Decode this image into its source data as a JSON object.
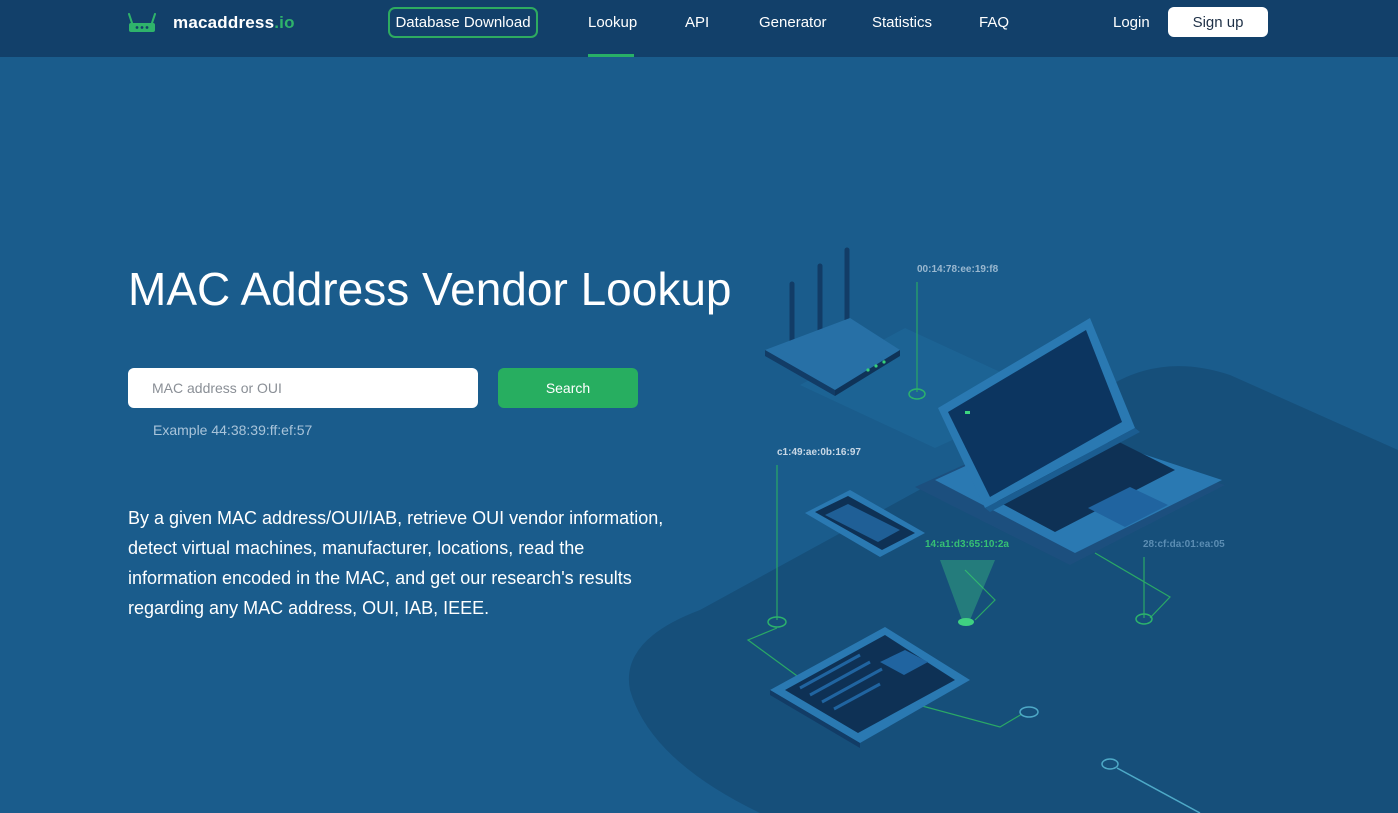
{
  "header": {
    "logo_name": "macaddress",
    "logo_tld": ".io",
    "db_button": "Database Download",
    "nav": [
      {
        "label": "Lookup",
        "active": true
      },
      {
        "label": "API"
      },
      {
        "label": "Generator"
      },
      {
        "label": "Statistics"
      },
      {
        "label": "FAQ"
      }
    ],
    "login": "Login",
    "signup": "Sign up"
  },
  "hero": {
    "title": "MAC Address Vendor Lookup",
    "search_placeholder": "MAC address or OUI",
    "search_button": "Search",
    "example": "Example 44:38:39:ff:ef:57",
    "description": "By a given MAC address/OUI/IAB, retrieve OUI vendor information, detect virtual machines, manufacturer, locations, read the information encoded in the MAC, and get our research's results regarding any MAC address, OUI, IAB, IEEE."
  },
  "illustration": {
    "labels": [
      "00:14:78:ee:19:f8",
      "c1:49:ae:0b:16:97",
      "14:a1:d3:65:10:2a",
      "28:cf:da:01:ea:05"
    ]
  },
  "colors": {
    "background": "#1a5c8c",
    "header": "#12406a",
    "accent_green": "#27ae60"
  },
  "icons": {
    "logo": "router-icon"
  }
}
